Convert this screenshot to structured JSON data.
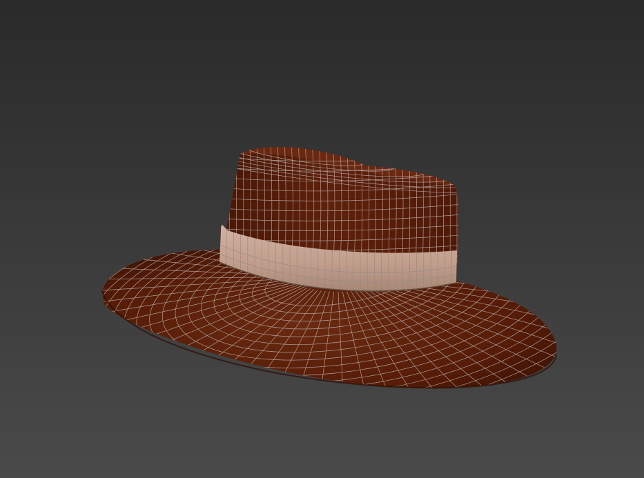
{
  "viewport": {
    "background_top": "#2a2a2a",
    "background_bottom": "#4a4a4a",
    "display_mode": "shaded-wireframe"
  },
  "model": {
    "object": "hat",
    "body_color": "#5a1d08",
    "body_shadow_color": "#3a1203",
    "body_highlight_color": "#7a3318",
    "band_color": "#c4a08d",
    "band_shadow_color": "#8f7262",
    "wire_color": "#c9c9c9"
  }
}
